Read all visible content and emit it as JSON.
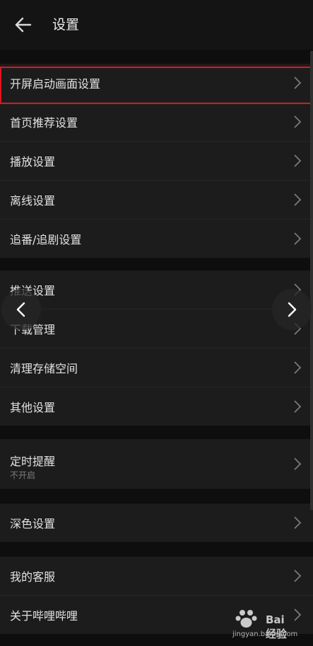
{
  "header": {
    "title": "设置",
    "back_icon": "back-arrow-icon"
  },
  "groups": [
    {
      "rows": [
        {
          "label": "开屏启动画面设置",
          "highlighted": true
        },
        {
          "label": "首页推荐设置"
        },
        {
          "label": "播放设置"
        },
        {
          "label": "离线设置"
        },
        {
          "label": "追番/追剧设置"
        }
      ]
    },
    {
      "rows": [
        {
          "label": "推送设置"
        },
        {
          "label": "下载管理"
        },
        {
          "label": "清理存储空间"
        },
        {
          "label": "其他设置"
        }
      ]
    },
    {
      "rows": [
        {
          "label": "定时提醒",
          "subtitle": "不开启"
        }
      ]
    },
    {
      "rows": [
        {
          "label": "深色设置"
        }
      ]
    },
    {
      "rows": [
        {
          "label": "我的客服"
        },
        {
          "label": "关于哔哩哔哩"
        }
      ]
    }
  ],
  "overlay": {
    "prev_icon": "chevron-left-icon",
    "next_icon": "chevron-right-icon",
    "highlight_color": "#e0141e"
  },
  "watermark": {
    "brand": "Bai 经验",
    "url": "jingyan.baidu.com"
  },
  "colors": {
    "background": "#0e0e0e",
    "row_bg": "#1c1c1c",
    "text": "#e2e2e2",
    "subtext": "#7d7d7d"
  }
}
